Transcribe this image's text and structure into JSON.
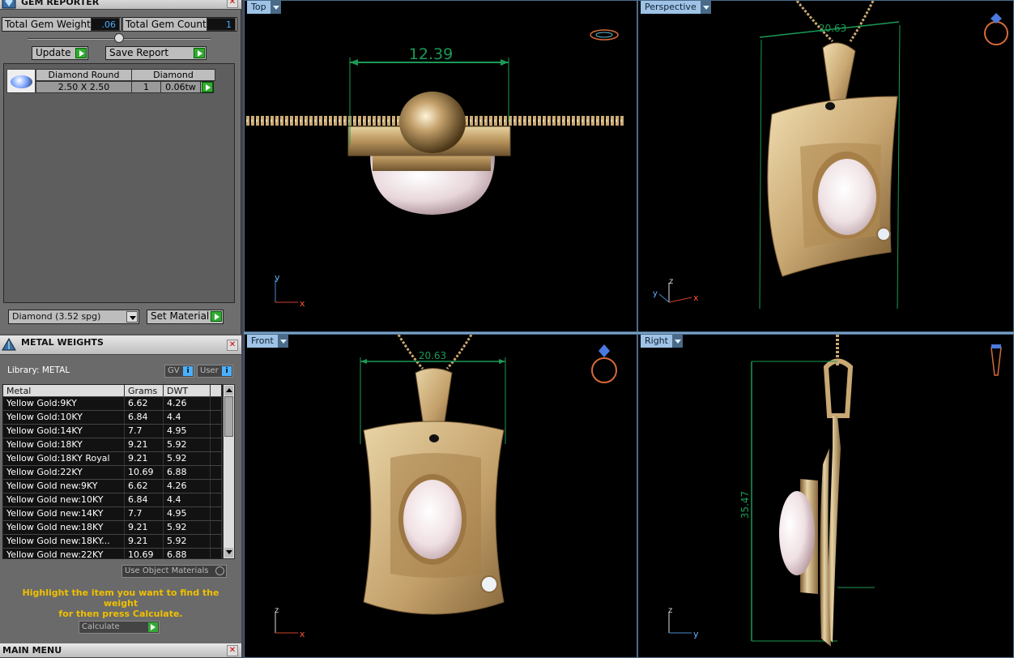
{
  "gem_reporter": {
    "title": "GEM REPORTER",
    "total_gem_weight_label": "Total Gem Weight",
    "total_gem_weight_value": ".06",
    "total_gem_count_label": "Total Gem Count",
    "total_gem_count_value": "1",
    "update_label": "Update",
    "save_report_label": "Save Report",
    "gem": {
      "cut": "Diamond Round",
      "type": "Diamond",
      "size": "2.50 X 2.50",
      "count": "1",
      "weight": "0.06tw"
    },
    "material_select": "Diamond    (3.52 spg)",
    "set_material_label": "Set Material"
  },
  "metal_weights": {
    "title": "METAL WEIGHTS",
    "library_label": "Library: METAL",
    "gv_label": "GV",
    "user_label": "User",
    "columns": [
      "Metal",
      "Grams",
      "DWT"
    ],
    "rows": [
      {
        "metal": "Yellow Gold:9KY",
        "grams": "6.62",
        "dwt": "4.26"
      },
      {
        "metal": "Yellow Gold:10KY",
        "grams": "6.84",
        "dwt": "4.4"
      },
      {
        "metal": "Yellow Gold:14KY",
        "grams": "7.7",
        "dwt": "4.95"
      },
      {
        "metal": "Yellow Gold:18KY",
        "grams": "9.21",
        "dwt": "5.92"
      },
      {
        "metal": "Yellow Gold:18KY Royal",
        "grams": "9.21",
        "dwt": "5.92"
      },
      {
        "metal": "Yellow Gold:22KY",
        "grams": "10.69",
        "dwt": "6.88"
      },
      {
        "metal": "Yellow Gold new:9KY",
        "grams": "6.62",
        "dwt": "4.26"
      },
      {
        "metal": "Yellow Gold new:10KY",
        "grams": "6.84",
        "dwt": "4.4"
      },
      {
        "metal": "Yellow Gold new:14KY",
        "grams": "7.7",
        "dwt": "4.95"
      },
      {
        "metal": "Yellow Gold new:18KY",
        "grams": "9.21",
        "dwt": "5.92"
      },
      {
        "metal": "Yellow Gold new:18KY...",
        "grams": "9.21",
        "dwt": "5.92"
      },
      {
        "metal": "Yellow Gold new:22KY",
        "grams": "10.69",
        "dwt": "6.88"
      }
    ],
    "use_object_materials_label": "Use Object Materials",
    "hint_line1": "Highlight the item you want to find the weight",
    "hint_line2": "for then press Calculate.",
    "calculate_label": "Calculate"
  },
  "main_menu": {
    "title": "MAIN MENU"
  },
  "viewports": {
    "top": {
      "label": "Top",
      "dimension": "12.39",
      "axis_v": "y",
      "axis_h": "x"
    },
    "perspective": {
      "label": "Perspective",
      "dimension": "20.63",
      "axis_v": "z",
      "axis_h": "x",
      "axis_d": "y"
    },
    "front": {
      "label": "Front",
      "dimension": "20.63",
      "axis_v": "z",
      "axis_h": "x"
    },
    "right": {
      "label": "Right",
      "dimension": "35.47",
      "axis_v": "z",
      "axis_h": "y"
    }
  },
  "colors": {
    "gold": "#c9a873",
    "gold_dark": "#8f6c3c",
    "dimension_green": "#1b9a55",
    "viewport_label_bg": "#9ec3e6",
    "hint_yellow": "#f0c000"
  }
}
